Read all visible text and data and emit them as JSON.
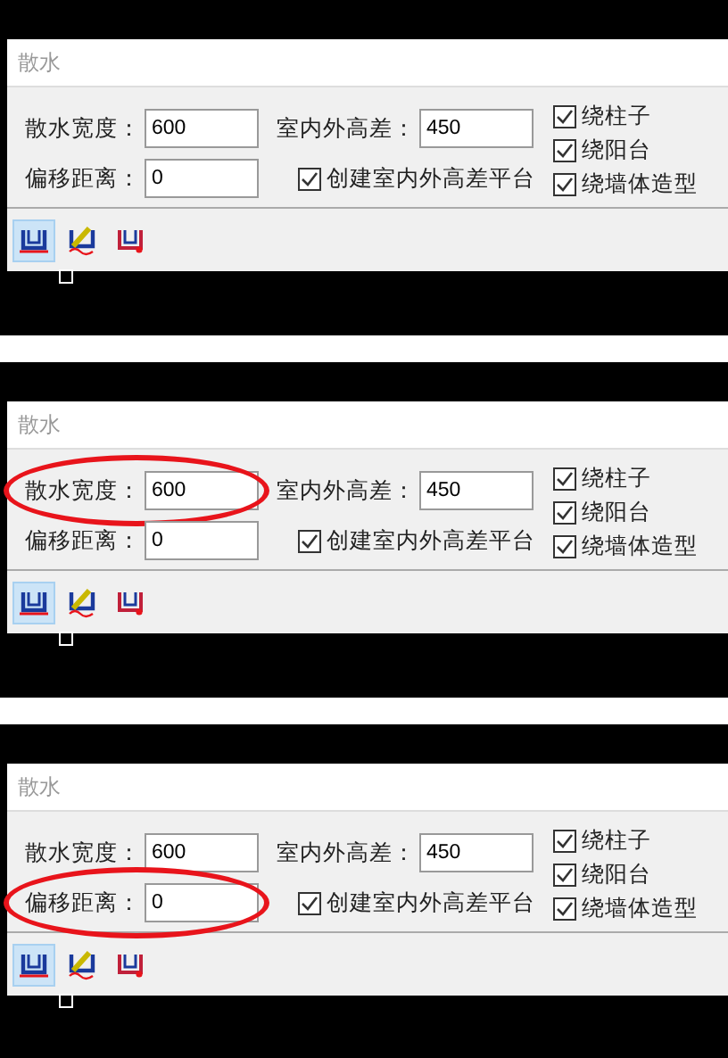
{
  "panels": [
    {
      "title": "散水",
      "fields": [
        {
          "label": "散水宽度：",
          "value": "600",
          "circled": false
        },
        {
          "label": "室内外高差：",
          "value": "450",
          "circled": false
        },
        {
          "label": "偏移距离：",
          "value": "0",
          "circled": false
        }
      ],
      "platform_option": {
        "label": "创建室内外高差平台",
        "checked": true
      },
      "wrap_options": [
        {
          "label": "绕柱子",
          "checked": true
        },
        {
          "label": "绕阳台",
          "checked": true
        },
        {
          "label": "绕墙体造型",
          "checked": true
        }
      ],
      "tools": [
        {
          "selected": true
        },
        {
          "selected": false
        },
        {
          "selected": false
        }
      ]
    },
    {
      "title": "散水",
      "fields": [
        {
          "label": "散水宽度：",
          "value": "600",
          "circled": true
        },
        {
          "label": "室内外高差：",
          "value": "450",
          "circled": false
        },
        {
          "label": "偏移距离：",
          "value": "0",
          "circled": false
        }
      ],
      "platform_option": {
        "label": "创建室内外高差平台",
        "checked": true
      },
      "wrap_options": [
        {
          "label": "绕柱子",
          "checked": true
        },
        {
          "label": "绕阳台",
          "checked": true
        },
        {
          "label": "绕墙体造型",
          "checked": true
        }
      ],
      "tools": [
        {
          "selected": true
        },
        {
          "selected": false
        },
        {
          "selected": false
        }
      ]
    },
    {
      "title": "散水",
      "fields": [
        {
          "label": "散水宽度：",
          "value": "600",
          "circled": false
        },
        {
          "label": "室内外高差：",
          "value": "450",
          "circled": false
        },
        {
          "label": "偏移距离：",
          "value": "0",
          "circled": true
        }
      ],
      "platform_option": {
        "label": "创建室内外高差平台",
        "checked": true
      },
      "wrap_options": [
        {
          "label": "绕柱子",
          "checked": true
        },
        {
          "label": "绕阳台",
          "checked": true
        },
        {
          "label": "绕墙体造型",
          "checked": true
        }
      ],
      "tools": [
        {
          "selected": true
        },
        {
          "selected": false
        },
        {
          "selected": false
        }
      ]
    }
  ]
}
